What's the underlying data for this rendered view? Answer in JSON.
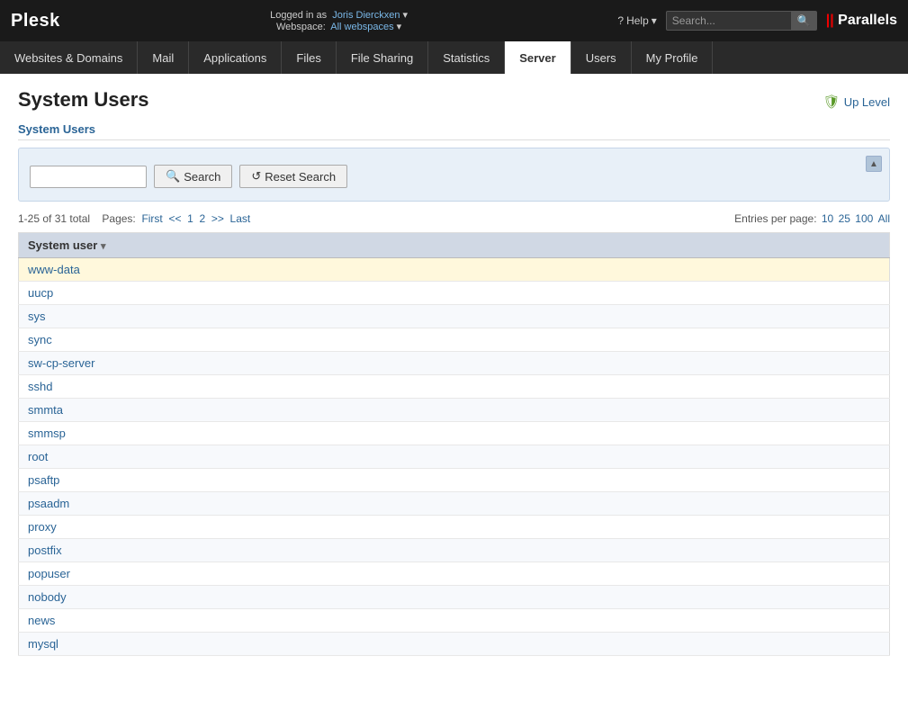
{
  "topbar": {
    "logo": "Plesk",
    "parallels_logo": "|| Parallels",
    "logged_in_as": "Logged in as",
    "username": "Joris Dierckxen",
    "webspace_label": "Webspace:",
    "webspace_value": "All webspaces",
    "help_label": "Help",
    "search_placeholder": "Search..."
  },
  "nav": {
    "items": [
      {
        "id": "websites-domains",
        "label": "Websites & Domains",
        "active": false
      },
      {
        "id": "mail",
        "label": "Mail",
        "active": false
      },
      {
        "id": "applications",
        "label": "Applications",
        "active": false
      },
      {
        "id": "files",
        "label": "Files",
        "active": false
      },
      {
        "id": "file-sharing",
        "label": "File Sharing",
        "active": false
      },
      {
        "id": "statistics",
        "label": "Statistics",
        "active": false
      },
      {
        "id": "server",
        "label": "Server",
        "active": true
      },
      {
        "id": "users",
        "label": "Users",
        "active": false
      },
      {
        "id": "my-profile",
        "label": "My Profile",
        "active": false
      }
    ]
  },
  "page": {
    "title": "System Users",
    "section_title": "System Users",
    "up_level_label": "Up Level"
  },
  "filter": {
    "search_label": "Search",
    "reset_label": "Reset Search"
  },
  "pagination": {
    "range": "1-25 of 31 total",
    "pages_label": "Pages:",
    "first": "First",
    "prev": "<<",
    "page1": "1",
    "page2": "2",
    "next": ">>",
    "last": "Last",
    "entries_label": "Entries per page:",
    "entry_10": "10",
    "entry_25": "25",
    "entry_100": "100",
    "entry_all": "All"
  },
  "table": {
    "column_header": "System user",
    "users": [
      {
        "name": "www-data",
        "highlighted": true
      },
      {
        "name": "uucp",
        "highlighted": false
      },
      {
        "name": "sys",
        "highlighted": false
      },
      {
        "name": "sync",
        "highlighted": false
      },
      {
        "name": "sw-cp-server",
        "highlighted": false
      },
      {
        "name": "sshd",
        "highlighted": false
      },
      {
        "name": "smmta",
        "highlighted": false
      },
      {
        "name": "smmsp",
        "highlighted": false
      },
      {
        "name": "root",
        "highlighted": false
      },
      {
        "name": "psaftp",
        "highlighted": false
      },
      {
        "name": "psaadm",
        "highlighted": false
      },
      {
        "name": "proxy",
        "highlighted": false
      },
      {
        "name": "postfix",
        "highlighted": false
      },
      {
        "name": "popuser",
        "highlighted": false
      },
      {
        "name": "nobody",
        "highlighted": false
      },
      {
        "name": "news",
        "highlighted": false
      },
      {
        "name": "mysql",
        "highlighted": false
      }
    ]
  }
}
